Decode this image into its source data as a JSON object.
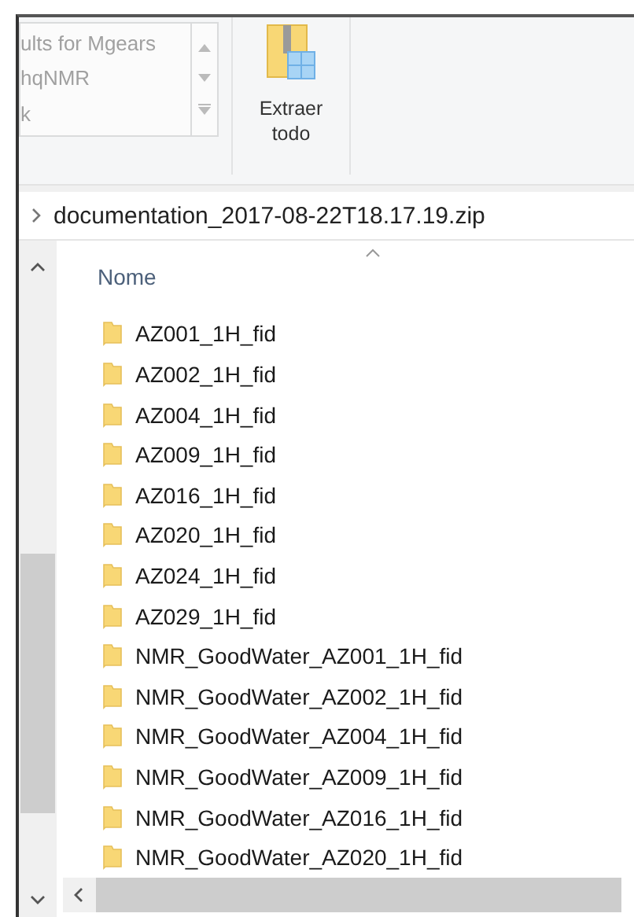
{
  "ribbon": {
    "gallery_items": [
      "ults for Mgears",
      "hqNMR",
      "k"
    ],
    "extract_button": {
      "label": "Extraer todo"
    }
  },
  "address_bar": {
    "path": "documentation_2017-08-22T18.17.19.zip"
  },
  "file_list": {
    "column_header": "Nome",
    "items": [
      {
        "name": "AZ001_1H_fid"
      },
      {
        "name": "AZ002_1H_fid"
      },
      {
        "name": "AZ004_1H_fid"
      },
      {
        "name": "AZ009_1H_fid"
      },
      {
        "name": "AZ016_1H_fid"
      },
      {
        "name": "AZ020_1H_fid"
      },
      {
        "name": "AZ024_1H_fid"
      },
      {
        "name": "AZ029_1H_fid"
      },
      {
        "name": "NMR_GoodWater_AZ001_1H_fid"
      },
      {
        "name": "NMR_GoodWater_AZ002_1H_fid"
      },
      {
        "name": "NMR_GoodWater_AZ004_1H_fid"
      },
      {
        "name": "NMR_GoodWater_AZ009_1H_fid"
      },
      {
        "name": "NMR_GoodWater_AZ016_1H_fid"
      },
      {
        "name": "NMR_GoodWater_AZ020_1H_fid"
      }
    ]
  }
}
